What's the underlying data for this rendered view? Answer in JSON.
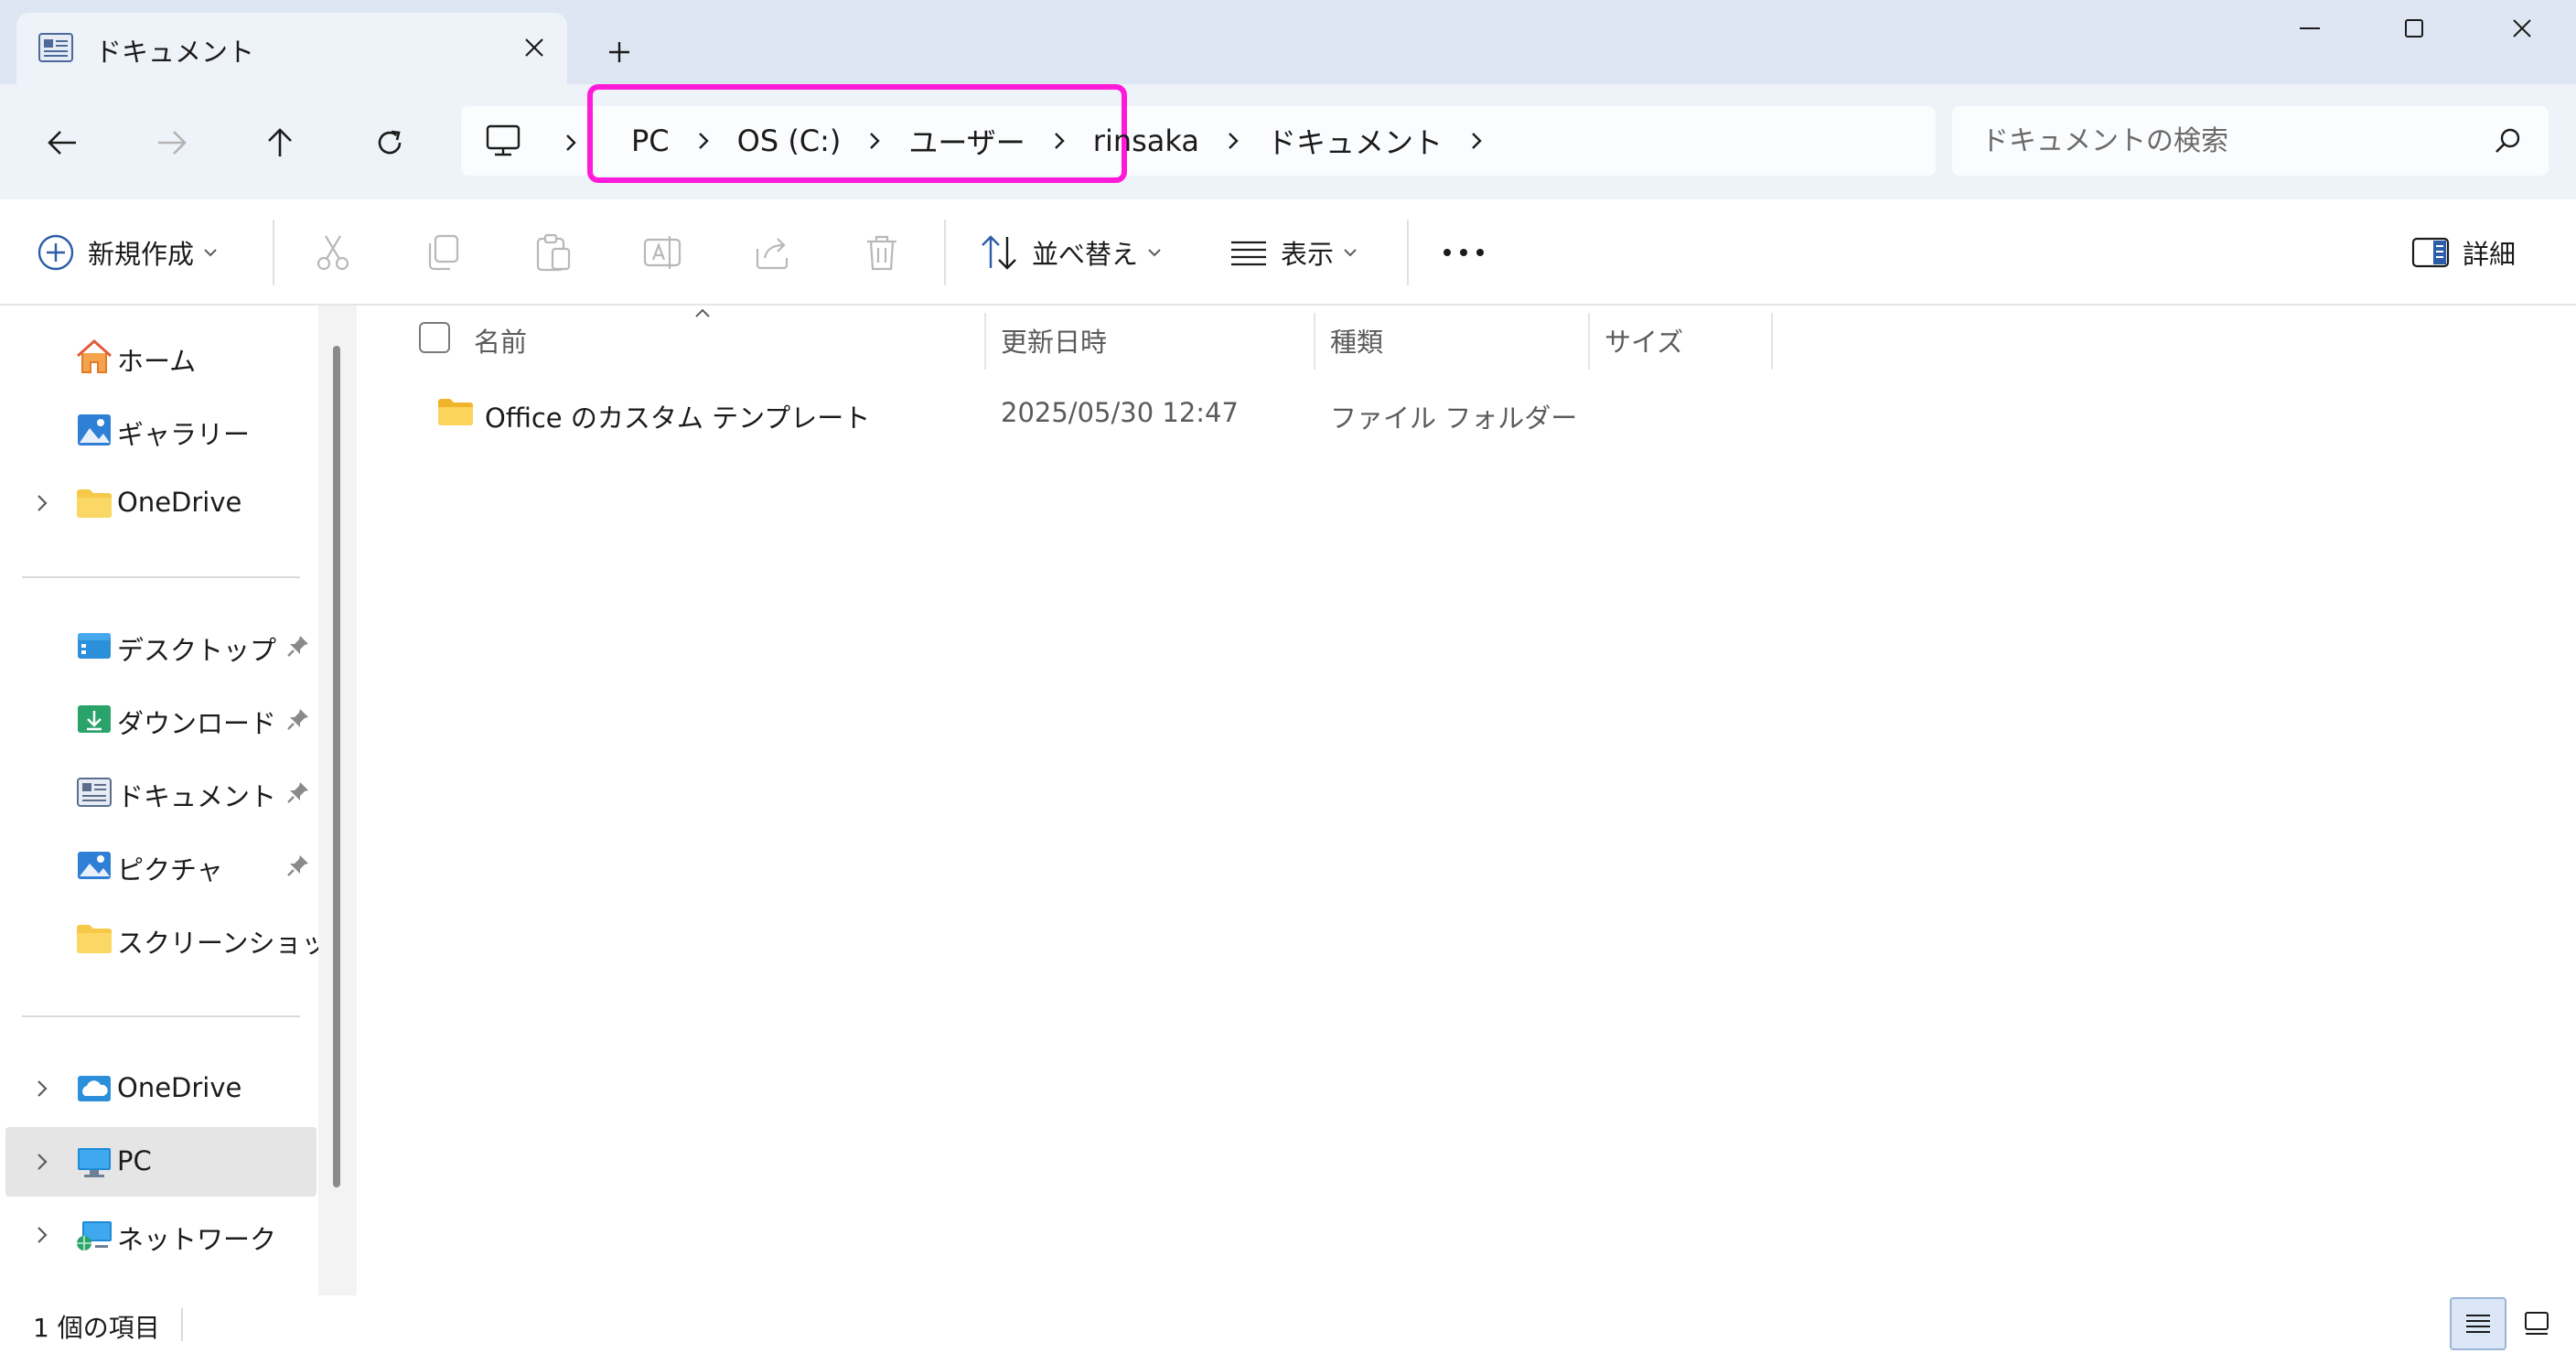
{
  "titlebar": {
    "tab_title": "ドキュメント",
    "new_tab_label": "+"
  },
  "nav": {
    "breadcrumbs": [
      "PC",
      "OS (C:)",
      "ユーザー",
      "rinsaka",
      "ドキュメント"
    ],
    "highlight_color": "#ff1ad9"
  },
  "search": {
    "placeholder": "ドキュメントの検索"
  },
  "commands": {
    "new_label": "新規作成",
    "sort_label": "並べ替え",
    "view_label": "表示",
    "details_label": "詳細"
  },
  "sidebar": {
    "top": [
      {
        "label": "ホーム",
        "icon": "home-icon"
      },
      {
        "label": "ギャラリー",
        "icon": "gallery-icon"
      },
      {
        "label": "OneDrive",
        "icon": "folder-icon"
      }
    ],
    "quick_access": [
      {
        "label": "デスクトップ",
        "icon": "desktop-icon"
      },
      {
        "label": "ダウンロード",
        "icon": "download-icon"
      },
      {
        "label": "ドキュメント",
        "icon": "documents-icon"
      },
      {
        "label": "ピクチャ",
        "icon": "pictures-icon"
      },
      {
        "label": "スクリーンショット",
        "icon": "folder-icon"
      }
    ],
    "locations": [
      {
        "label": "OneDrive",
        "icon": "cloud-icon"
      },
      {
        "label": "PC",
        "icon": "pc-icon"
      },
      {
        "label": "ネットワーク",
        "icon": "network-icon"
      }
    ]
  },
  "columns": {
    "name": "名前",
    "date": "更新日時",
    "type": "種類",
    "size": "サイズ"
  },
  "files": [
    {
      "name": "Office のカスタム テンプレート",
      "date": "2025/05/30 12:47",
      "type": "ファイル フォルダー",
      "size": ""
    }
  ],
  "status": {
    "count": "1 個の項目"
  }
}
